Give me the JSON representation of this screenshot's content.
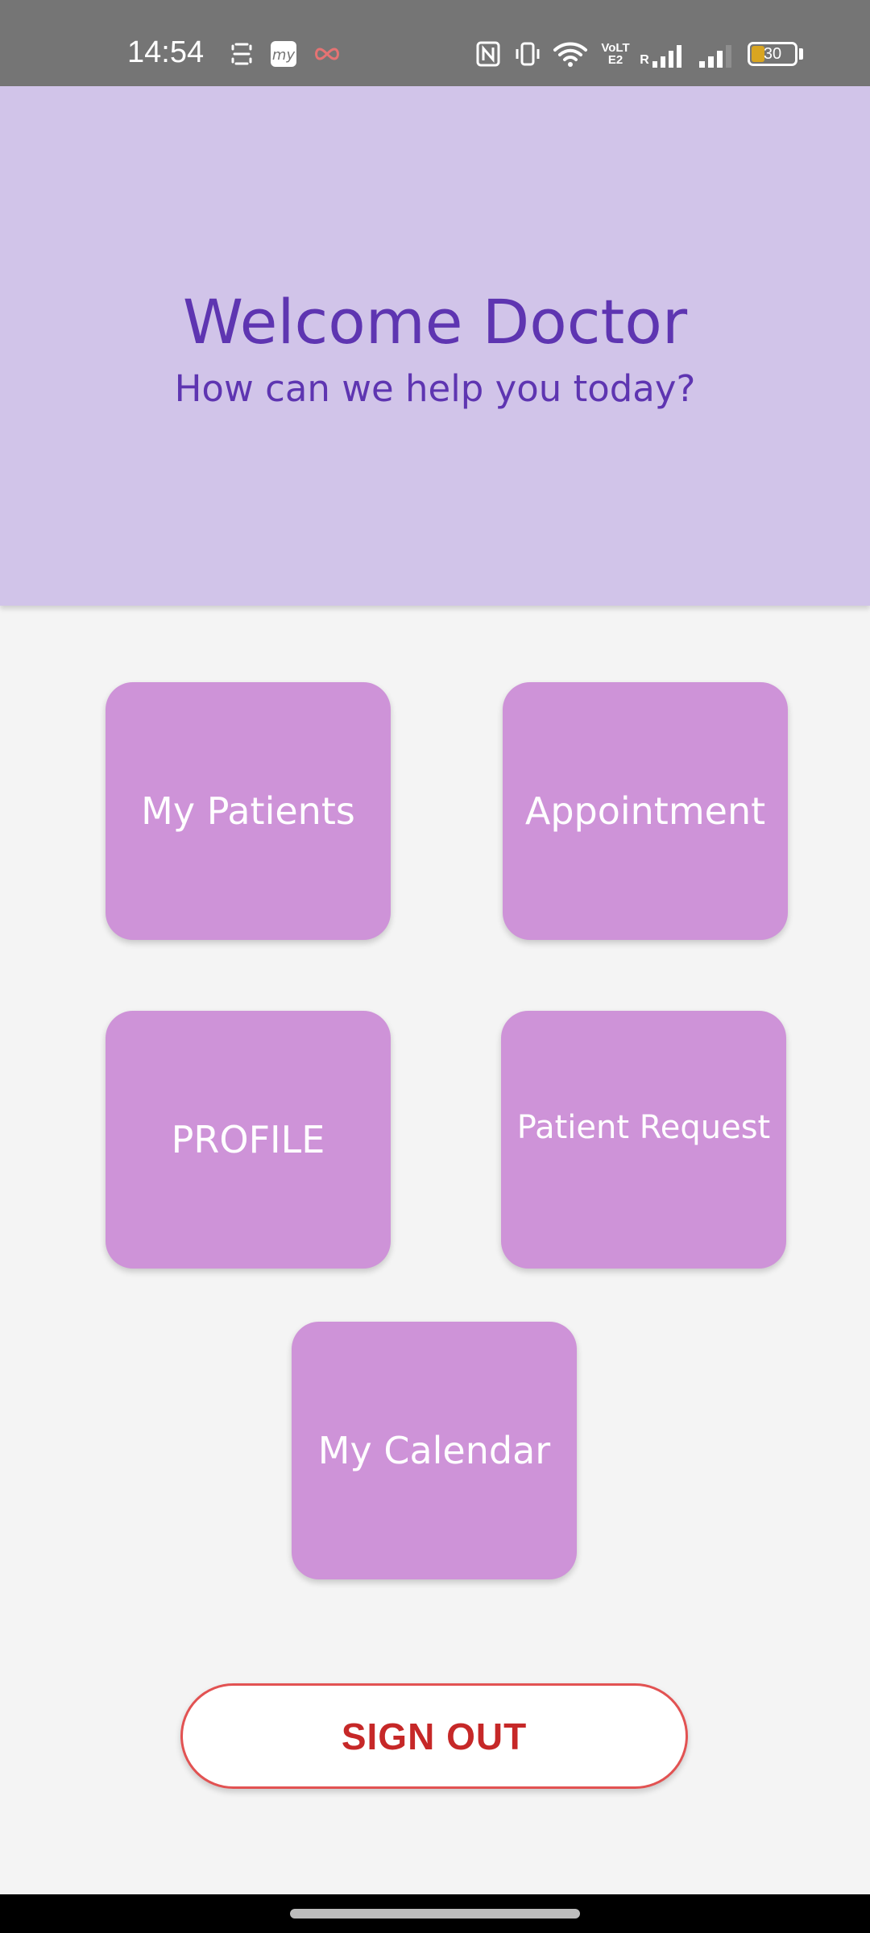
{
  "status_bar": {
    "time": "14:54",
    "battery_level": "30",
    "battery_fraction": 0.3,
    "icons_left": [
      "screen-capture-icon",
      "my-app-icon",
      "infinity-icon"
    ],
    "icons_right": [
      "nfc-icon",
      "vibrate-icon",
      "wifi-icon",
      "volte-icon",
      "signal-roaming-icon",
      "signal-icon"
    ],
    "volte_text": "VoLTE2",
    "roaming_text": "R"
  },
  "header": {
    "title": "Welcome Doctor",
    "subtitle": "How can we help you today?",
    "background": "#d1c4e9",
    "text_color": "#5e35b1"
  },
  "tiles": {
    "my_patients": "My Patients",
    "appointment": "Appointment",
    "profile": "PROFILE",
    "patient_request": "Patient Request",
    "my_calendar": "My Calendar",
    "color": "#ce93d8"
  },
  "signout": {
    "label": "SIGN OUT",
    "color": "#c62828"
  }
}
